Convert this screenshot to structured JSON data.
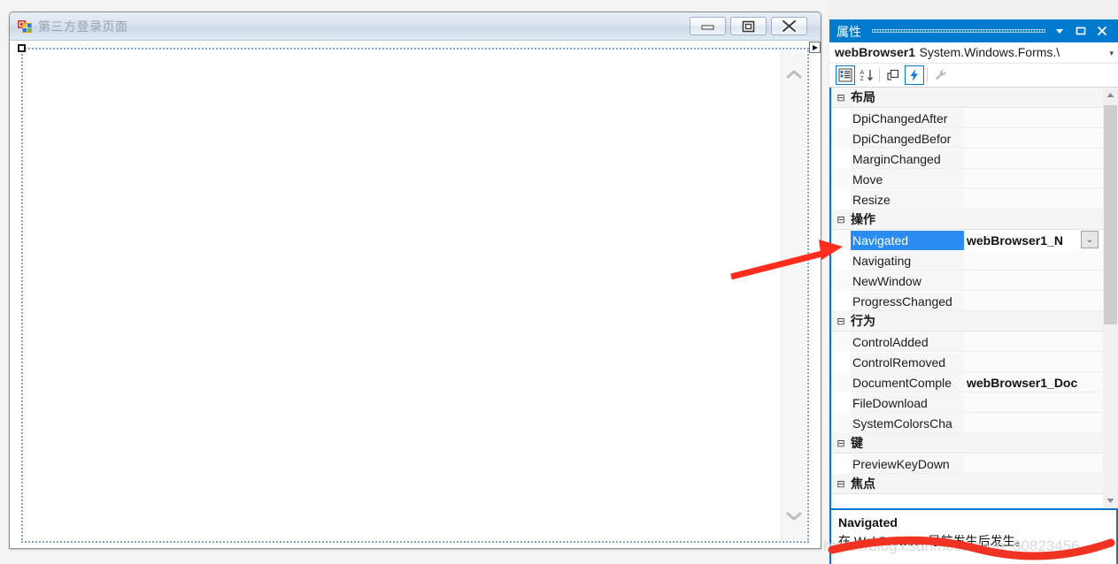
{
  "designer": {
    "form_window": {
      "title": "第三方登录页面",
      "icon": "winform-icon",
      "buttons": [
        {
          "name": "minimize",
          "glyph": "minimize-icon"
        },
        {
          "name": "maximize",
          "glyph": "maximize-icon"
        },
        {
          "name": "close",
          "glyph": "close-icon"
        }
      ],
      "control": {
        "name": "webBrowser1",
        "scrollbar": {
          "up": "chevron-up-icon",
          "down": "chevron-down-icon"
        }
      }
    }
  },
  "properties_panel": {
    "header": {
      "title": "属性",
      "buttons": [
        "dropdown-icon",
        "maximize-icon",
        "close-icon"
      ]
    },
    "object_selector": {
      "name": "webBrowser1",
      "type": "System.Windows.Forms.\\",
      "arrow": "▾"
    },
    "toolbar": [
      {
        "name": "categorized",
        "icon": "categorized-icon",
        "active": true
      },
      {
        "name": "alphabetical",
        "icon": "sort-alpha-icon",
        "active": false
      },
      {
        "name": "properties",
        "icon": "properties-icon",
        "active": false
      },
      {
        "name": "events",
        "icon": "lightning-icon",
        "active": true
      },
      {
        "name": "property-pages",
        "icon": "wrench-icon",
        "active": false
      }
    ],
    "grid": [
      {
        "category": "布局",
        "toggle": "⊟",
        "rows": [
          {
            "name": "DpiChangedAfter",
            "value": ""
          },
          {
            "name": "DpiChangedBefor",
            "value": ""
          },
          {
            "name": "MarginChanged",
            "value": ""
          },
          {
            "name": "Move",
            "value": ""
          },
          {
            "name": "Resize",
            "value": ""
          }
        ]
      },
      {
        "category": "操作",
        "toggle": "⊟",
        "rows": [
          {
            "name": "Navigated",
            "value": "webBrowser1_N",
            "selected": true,
            "dropdown": "⌄"
          },
          {
            "name": "Navigating",
            "value": ""
          },
          {
            "name": "NewWindow",
            "value": ""
          },
          {
            "name": "ProgressChanged",
            "value": ""
          }
        ]
      },
      {
        "category": "行为",
        "toggle": "⊟",
        "rows": [
          {
            "name": "ControlAdded",
            "value": ""
          },
          {
            "name": "ControlRemoved",
            "value": ""
          },
          {
            "name": "DocumentComple",
            "value": "webBrowser1_Doc"
          },
          {
            "name": "FileDownload",
            "value": ""
          },
          {
            "name": "SystemColorsCha",
            "value": ""
          }
        ]
      },
      {
        "category": "键",
        "toggle": "⊟",
        "rows": [
          {
            "name": "PreviewKeyDown",
            "value": ""
          }
        ]
      },
      {
        "category": "焦点",
        "toggle": "⊟",
        "rows": []
      }
    ],
    "description": {
      "title": "Navigated",
      "text": "在 WebBrowser 导航发生后发生。"
    },
    "scrollbar": {
      "up": "triangle-up-icon",
      "down": "triangle-down-icon"
    }
  },
  "annotations": {
    "watermark": "https://blog.csdn.net/weixin_50823456",
    "arrow_color": "#ff2d1e",
    "scribble_color": "#f03223"
  }
}
